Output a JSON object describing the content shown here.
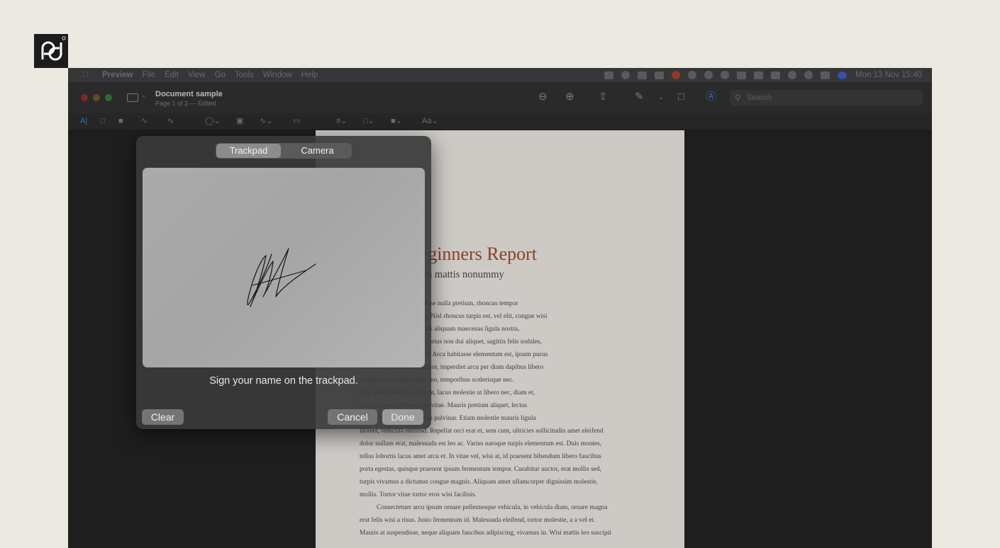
{
  "brand": {
    "logo_text": "pd",
    "logo_color": "#1c1c1c"
  },
  "menubar": {
    "app_name": "Preview",
    "items": [
      "File",
      "Edit",
      "View",
      "Go",
      "Tools",
      "Window",
      "Help"
    ],
    "clock": "Mon 13 Nov  15:40"
  },
  "window": {
    "doc_title": "Document sample",
    "doc_subtitle": "Page 1 of 2 — Edited",
    "search_placeholder": "Search",
    "font_button": "Aa"
  },
  "document": {
    "title": "gy for Beginners Report",
    "subtitle": "et lacus quis enim mattis nonummy",
    "lines": [
      "r sit amet, ligula suspendisse nulla pretium, rhoncus tempor",
      "er ad vestibulum volutpat. Nisl rhoncus turpis est, vel elit, congue wisi",
      "magna tincidunt. Maecenas aliquam maecenas ligula nostra,",
      "mauris in integer, a dolor netus non dui aliquet, sagittis felis sodales,",
      "eu libero cras. Faucibus at. Arcu habitasse elementum est, ipsum purus",
      "adipiscing, aliquet sed auctor, imperdiet arcu per diam dapibus libero",
      "volutpat nec pellentesque leo, temporibus scelerisque nec.",
      "cing amet bibendum nullam, lacus molestie ut libero nec, diam et,",
      "t ullamcorper id tempor id vitae. Mauris pretium aliquet, lectus",
      "is imperdiet libero senectus pulvinar. Etiam molestie mauris ligula",
      "laoreet, vehicula eleifend. Repellat orci erat et, sem cum, ultricies sollicitudin amet eleifend",
      "dolor nullam erat, malesuada est leo ac. Varius natoque turpis elementum est. Duis montes,",
      "tellus lobortis lacus amet arcu et. In vitae vel, wisi at, id praesent bibendum libero faucibus",
      "porta egestas, quisque praesent ipsum fermentum tempor. Curabitur auctor, erat mollis sed,",
      "turpis vivamus a dictumst congue magnis. Aliquam amet ullamcorper dignissim molestie,",
      "mollis. Tortor vitae tortor eros wisi facilisis.",
      "Consectetuer arcu ipsum ornare pellentesque vehicula, in vehicula diam, ornare magna",
      "erat felis wisi a risus. Justo fermentum id. Malesuada eleifend, tortor molestie, a a vel et.",
      "Mauris at suspendisse, neque aliquam faucibus adipiscing, vivamus in. Wisi mattis leo suscipit"
    ]
  },
  "signature_panel": {
    "tabs": [
      "Trackpad",
      "Camera"
    ],
    "selected_tab": "Trackpad",
    "instruction": "Sign your name on the trackpad.",
    "clear_label": "Clear",
    "cancel_label": "Cancel",
    "done_label": "Done"
  },
  "colors": {
    "accent_title": "#8a3f26",
    "panel_bg": "#3a3a3a",
    "traffic_close": "#7a2c28",
    "traffic_min": "#5c4d2a",
    "traffic_max": "#2d6a32"
  }
}
